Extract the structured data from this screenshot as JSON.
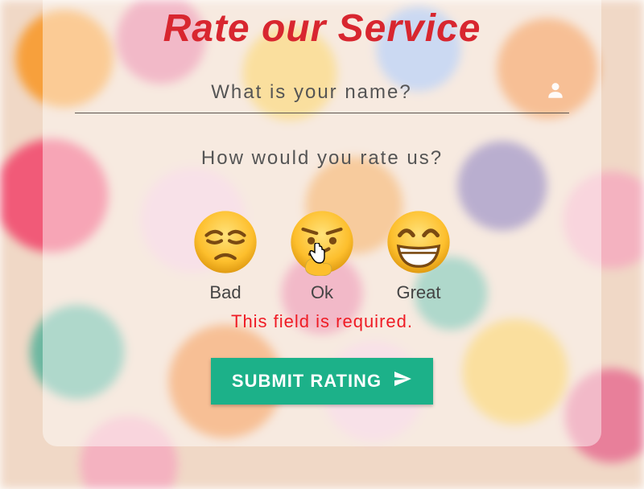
{
  "title": "Rate our Service",
  "name_field": {
    "placeholder": "What is your name?",
    "value": ""
  },
  "question": "How would you rate us?",
  "options": [
    {
      "emoji": "pensive",
      "label": "Bad"
    },
    {
      "emoji": "thinking",
      "label": "Ok"
    },
    {
      "emoji": "grin",
      "label": "Great"
    }
  ],
  "error": "This field is required.",
  "submit_label": "SUBMIT RATING",
  "colors": {
    "accent_red": "#d8262f",
    "button": "#1cb189",
    "error": "#ef1b24"
  }
}
